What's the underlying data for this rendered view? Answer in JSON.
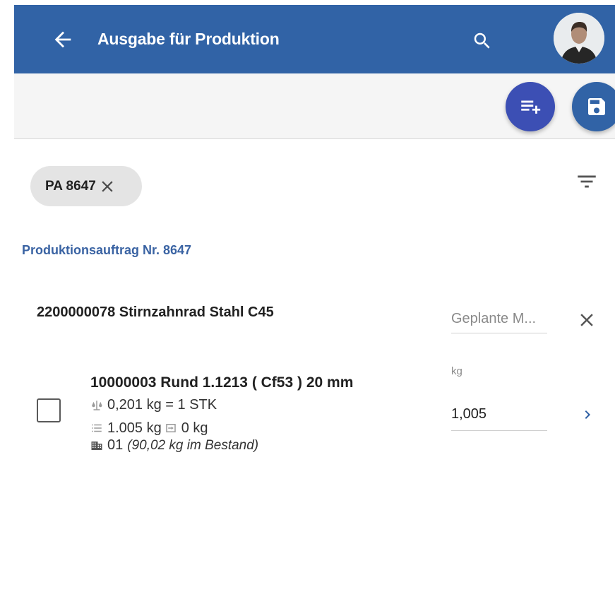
{
  "header": {
    "title": "Ausgabe für Produktion"
  },
  "colors": {
    "primary": "#3163a6",
    "accent": "#3c4fb4",
    "link": "#3a63a3",
    "chevron": "#2e5fa4"
  },
  "icons": {
    "back": "arrow-left-icon",
    "search": "search-icon",
    "add": "playlist-add-icon",
    "save": "save-icon",
    "filter": "filter-list-icon",
    "close": "close-icon",
    "chevron": "chevron-right-icon"
  },
  "filter_chip": {
    "label": "PA 8647"
  },
  "order": {
    "heading": "Produktionsauftrag Nr. 8647",
    "product": {
      "title": "2200000078 Stirnzahnrad Stahl C45",
      "planned_placeholder": "Geplante M..."
    },
    "item": {
      "title": "10000003 Rund 1.1213 ( Cf53 ) 20 mm",
      "conversion": "0,201 kg = 1 STK",
      "required": "1.005 kg",
      "issued": "0 kg",
      "warehouse": "01",
      "stock_note": "(90,02 kg im Bestand)",
      "unit": "kg",
      "quantity": "1,005"
    }
  }
}
